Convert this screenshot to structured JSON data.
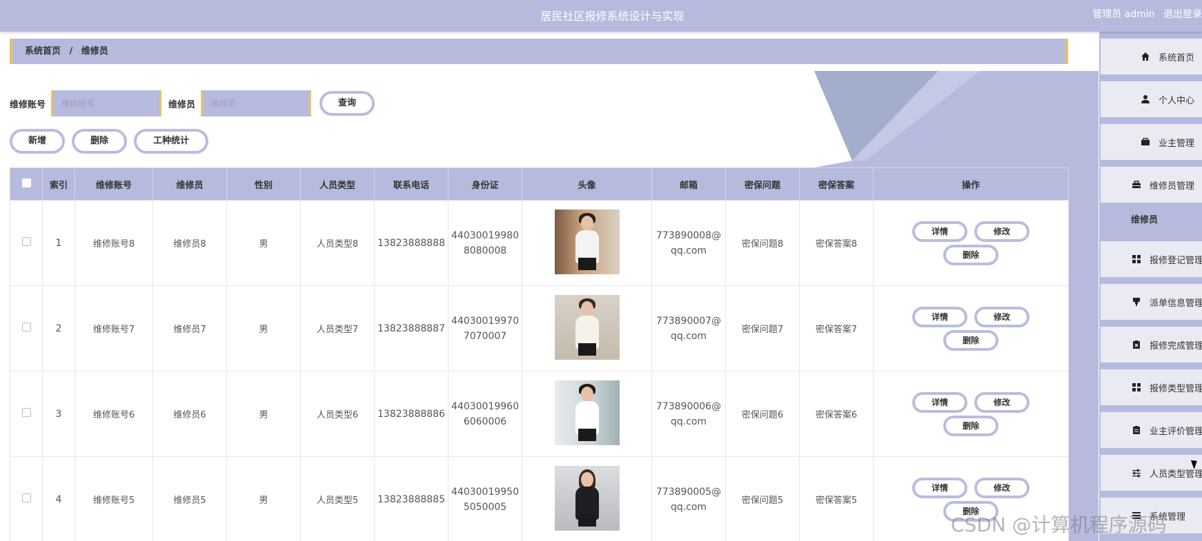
{
  "header": {
    "title": "居民社区报修系统设计与实现",
    "user_label": "管理员 admin",
    "logout_label": "退出登录"
  },
  "breadcrumb": {
    "home": "系统首页",
    "separator": "/",
    "current": "维修员"
  },
  "search": {
    "account_label": "维修账号",
    "account_placeholder": "维修账号",
    "name_label": "维修员",
    "name_placeholder": "维修员",
    "query_label": "查询"
  },
  "actions": {
    "add": "新增",
    "delete": "删除",
    "stats": "工种统计"
  },
  "table": {
    "headers": [
      "索引",
      "维修账号",
      "维修员",
      "性别",
      "人员类型",
      "联系电话",
      "身份证",
      "头像",
      "邮箱",
      "密保问题",
      "密保答案",
      "操作"
    ],
    "rows": [
      {
        "index": "1",
        "account": "维修账号8",
        "name": "维修员8",
        "gender": "男",
        "type": "人员类型8",
        "phone": "13823888888",
        "id_line1": "44030019980",
        "id_line2": "8080008",
        "email_line1": "773890008@",
        "email_line2": "qq.com",
        "question": "密保问题8",
        "answer": "密保答案8"
      },
      {
        "index": "2",
        "account": "维修账号7",
        "name": "维修员7",
        "gender": "男",
        "type": "人员类型7",
        "phone": "13823888887",
        "id_line1": "44030019970",
        "id_line2": "7070007",
        "email_line1": "773890007@",
        "email_line2": "qq.com",
        "question": "密保问题7",
        "answer": "密保答案7"
      },
      {
        "index": "3",
        "account": "维修账号6",
        "name": "维修员6",
        "gender": "男",
        "type": "人员类型6",
        "phone": "13823888886",
        "id_line1": "44030019960",
        "id_line2": "6060006",
        "email_line1": "773890006@",
        "email_line2": "qq.com",
        "question": "密保问题6",
        "answer": "密保答案6"
      },
      {
        "index": "4",
        "account": "维修账号5",
        "name": "维修员5",
        "gender": "男",
        "type": "人员类型5",
        "phone": "13823888885",
        "id_line1": "44030019950",
        "id_line2": "5050005",
        "email_line1": "773890005@",
        "email_line2": "qq.com",
        "question": "密保问题5",
        "answer": "密保答案5"
      }
    ],
    "op_detail": "详情",
    "op_edit": "修改",
    "op_delete": "删除"
  },
  "sidebar": {
    "items": [
      {
        "label": "系统首页",
        "icon": "home-icon"
      },
      {
        "label": "个人中心",
        "icon": "user-icon"
      },
      {
        "label": "业主管理",
        "icon": "briefcase-icon"
      },
      {
        "label": "维修员管理",
        "icon": "toolbox-icon"
      },
      {
        "label": "维修员",
        "icon": ""
      },
      {
        "label": "报修登记管理",
        "icon": "grid-icon"
      },
      {
        "label": "派单信息管理",
        "icon": "stamp-icon"
      },
      {
        "label": "报修完成管理",
        "icon": "clipboard-x-icon"
      },
      {
        "label": "报修类型管理",
        "icon": "grid-icon"
      },
      {
        "label": "业主评价管理",
        "icon": "clipboard-icon"
      },
      {
        "label": "人员类型管理",
        "icon": "sliders-icon"
      },
      {
        "label": "系统管理",
        "icon": "menu-icon"
      }
    ]
  },
  "colors": {
    "primary": "#b6bbde",
    "accent": "#e7c26a",
    "button_border": "#b8bde0"
  },
  "watermark": "CSDN @计算机程序源码"
}
